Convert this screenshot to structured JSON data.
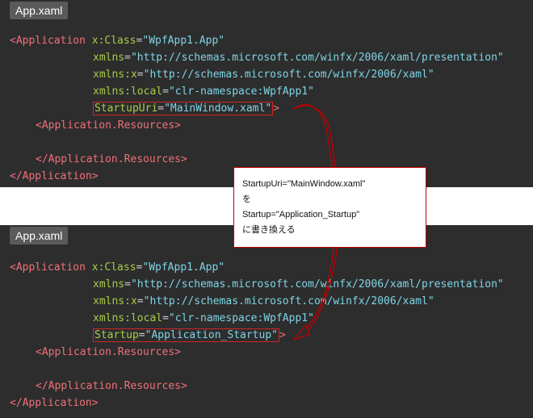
{
  "top": {
    "tab_label": "App.xaml",
    "lines": {
      "l1": {
        "tag": "<Application",
        "attr": "x:Class",
        "eq": "=",
        "val": "\"WpfApp1.App\""
      },
      "l2": {
        "attr": "xmlns",
        "eq": "=",
        "val": "\"http://schemas.microsoft.com/winfx/2006/xaml/presentation\""
      },
      "l3": {
        "attr": "xmlns:x",
        "eq": "=",
        "val": "\"http://schemas.microsoft.com/winfx/2006/xaml\""
      },
      "l4": {
        "attr": "xmlns:local",
        "eq": "=",
        "val": "\"clr-namespace:WpfApp1\""
      },
      "l5": {
        "attr": "StartupUri",
        "eq": "=",
        "val": "\"MainWindow.xaml\"",
        "close": ">"
      },
      "l6": {
        "tag": "<Application.Resources>"
      },
      "l8": {
        "tag": "</Application.Resources>"
      },
      "l9": {
        "tag": "</Application>"
      }
    }
  },
  "bottom": {
    "tab_label": "App.xaml",
    "lines": {
      "l1": {
        "tag": "<Application",
        "attr": "x:Class",
        "eq": "=",
        "val": "\"WpfApp1.App\""
      },
      "l2": {
        "attr": "xmlns",
        "eq": "=",
        "val": "\"http://schemas.microsoft.com/winfx/2006/xaml/presentation\""
      },
      "l3": {
        "attr": "xmlns:x",
        "eq": "=",
        "val": "\"http://schemas.microsoft.com/winfx/2006/xaml\""
      },
      "l4": {
        "attr": "xmlns:local",
        "eq": "=",
        "val": "\"clr-namespace:WpfApp1\""
      },
      "l5": {
        "attr": "Startup",
        "eq": "=",
        "val": "\"Application_Startup\"",
        "close": ">"
      },
      "l6": {
        "tag": "<Application.Resources>"
      },
      "l8": {
        "tag": "</Application.Resources>"
      },
      "l9": {
        "tag": "</Application>"
      }
    }
  },
  "callout": {
    "line1": "StartupUri=\"MainWindow.xaml\"",
    "line2": "を",
    "line3": "Startup=\"Application_Startup\"",
    "line4": "に書き換える"
  },
  "colors": {
    "panel_bg": "#2d2d2d",
    "tag": "#f07178",
    "attr": "#a8cc4a",
    "string": "#7fd4e6",
    "highlight_border": "#d42525",
    "arrow": "#c00000"
  }
}
